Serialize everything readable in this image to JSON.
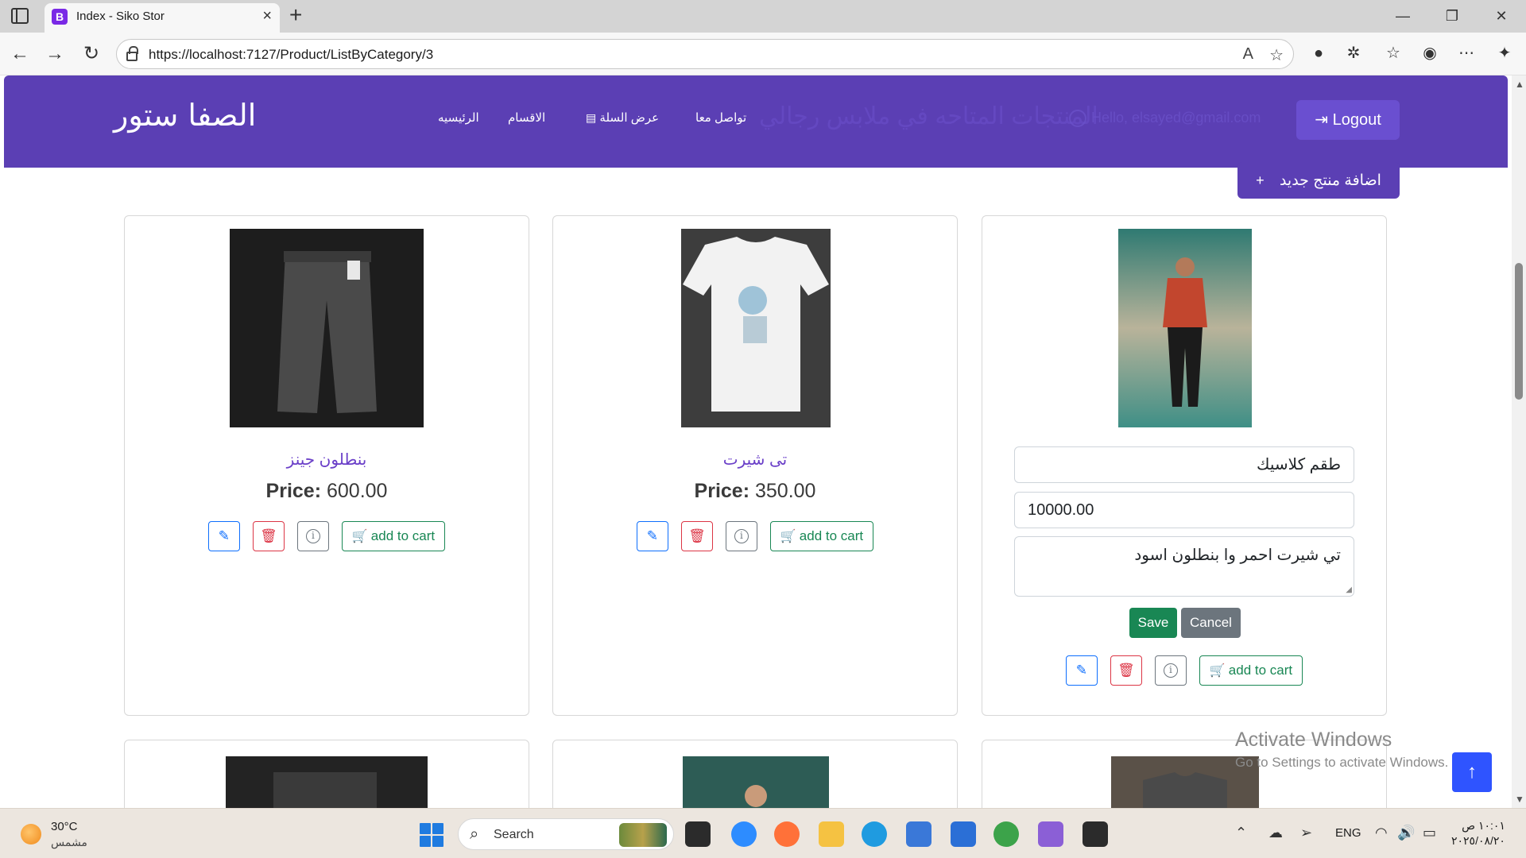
{
  "browser": {
    "tab_title": "Index - Siko Stor",
    "tab_favicon_letter": "B",
    "url": "https://localhost:7127/Product/ListByCategory/3"
  },
  "navbar": {
    "brand": "الصفا ستور",
    "links": [
      "الرئيسيه",
      "الاقسام",
      "عرض السلة",
      "تواصل معا"
    ],
    "ghost_title": "المنتجات المتاحه في ملابس رجالي",
    "hello": "Hello, elsayed@gmail.com",
    "logout": "Logout"
  },
  "add_product": "اضافة منتج جديد",
  "products": [
    {
      "name": "بنطلون جينز",
      "price_label": "Price:",
      "price": "600.00",
      "add_to_cart": "add to cart"
    },
    {
      "name": "تى شيرت",
      "price_label": "Price:",
      "price": "350.00",
      "add_to_cart": "add to cart"
    },
    {
      "edit_name": "طقم كلاسيك",
      "edit_price": "10000.00",
      "edit_description": "تي شيرت احمر وا بنطلون اسود",
      "save": "Save",
      "cancel": "Cancel",
      "add_to_cart": "add to cart"
    }
  ],
  "activate_windows": {
    "title": "Activate Windows",
    "subtitle": "Go to Settings to activate Windows."
  },
  "taskbar": {
    "weather_temp": "30°C",
    "weather_desc": "مشمس",
    "search": "Search",
    "lang": "ENG",
    "time": "١٠:٠١ ص",
    "date": "٢٠٢٥/٠٨/٢٠"
  },
  "colors": {
    "navbar": "#5b3fb4",
    "accent_text": "#6a3fc8",
    "save": "#198754",
    "cancel": "#6c757d",
    "back_to_top": "#2f54ff"
  }
}
